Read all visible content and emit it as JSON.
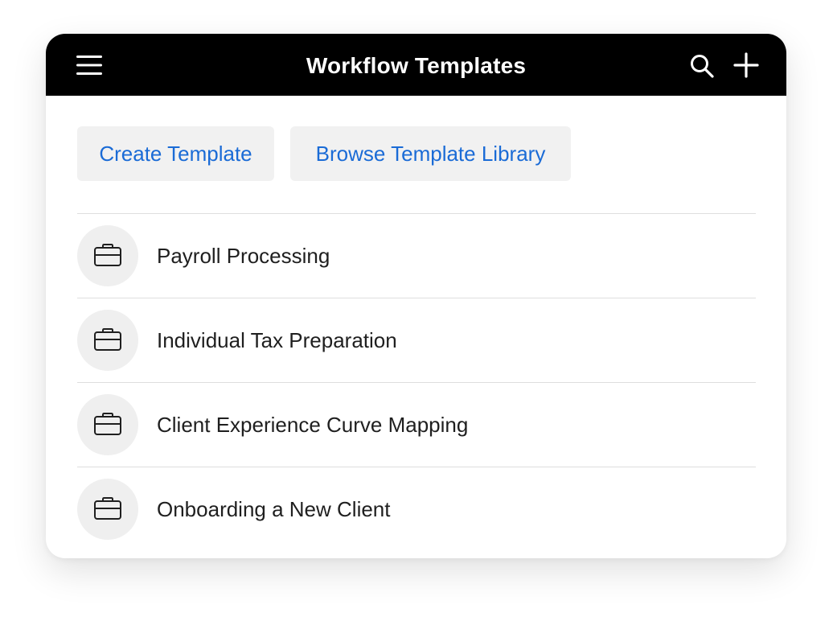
{
  "header": {
    "title": "Workflow Templates",
    "icons": [
      "menu-icon",
      "search-icon",
      "plus-icon"
    ],
    "background": "#000000",
    "text_color": "#ffffff"
  },
  "actions": {
    "create_label": "Create Template",
    "browse_label": "Browse Template Library",
    "link_color": "#1a6bd6"
  },
  "templates": [
    {
      "label": "Payroll Processing",
      "icon": "briefcase-icon"
    },
    {
      "label": "Individual Tax Preparation",
      "icon": "briefcase-icon"
    },
    {
      "label": "Client Experience Curve Mapping",
      "icon": "briefcase-icon"
    },
    {
      "label": "Onboarding a New Client",
      "icon": "briefcase-icon"
    }
  ]
}
